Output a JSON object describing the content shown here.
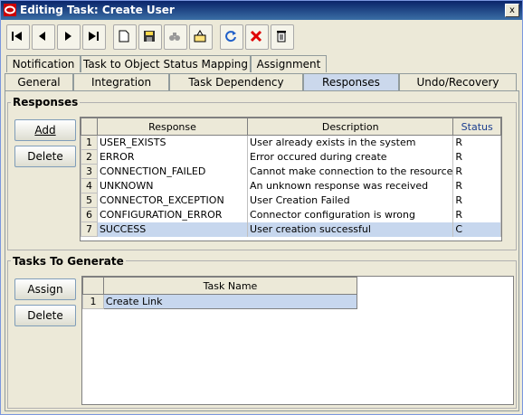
{
  "window": {
    "title": "Editing Task: Create User",
    "close_label": "x"
  },
  "toolbar": {
    "buttons": [
      {
        "icon": "first-record-icon"
      },
      {
        "icon": "previous-record-icon"
      },
      {
        "icon": "next-record-icon"
      },
      {
        "icon": "last-record-icon"
      },
      {
        "icon": "new-document-icon"
      },
      {
        "icon": "save-icon"
      },
      {
        "icon": "find-icon"
      },
      {
        "icon": "assign-icon"
      },
      {
        "icon": "refresh-icon"
      },
      {
        "icon": "delete-x-icon"
      },
      {
        "icon": "trash-icon"
      }
    ]
  },
  "tabs": {
    "row1": [
      "Notification",
      "Task to Object Status Mapping",
      "Assignment"
    ],
    "row2": [
      "General",
      "Integration",
      "Task Dependency",
      "Responses",
      "Undo/Recovery"
    ],
    "active": "Responses"
  },
  "responses": {
    "title": "Responses",
    "add_label": "Add",
    "delete_label": "Delete",
    "columns": [
      "Response",
      "Description",
      "Status"
    ],
    "rows": [
      {
        "n": "1",
        "response": "USER_EXISTS",
        "description": "User already exists in the system",
        "status": "R"
      },
      {
        "n": "2",
        "response": "ERROR",
        "description": "Error occured during create",
        "status": "R"
      },
      {
        "n": "3",
        "response": "CONNECTION_FAILED",
        "description": "Cannot make connection to the resource",
        "status": "R"
      },
      {
        "n": "4",
        "response": "UNKNOWN",
        "description": "An unknown response was received",
        "status": "R"
      },
      {
        "n": "5",
        "response": "CONNECTOR_EXCEPTION",
        "description": "User Creation Failed",
        "status": "R"
      },
      {
        "n": "6",
        "response": "CONFIGURATION_ERROR",
        "description": "Connector configuration is wrong",
        "status": "R"
      },
      {
        "n": "7",
        "response": "SUCCESS",
        "description": "User creation successful",
        "status": "C"
      }
    ],
    "selected_row": "7"
  },
  "tasks": {
    "title": "Tasks To Generate",
    "assign_label": "Assign",
    "delete_label": "Delete",
    "columns": [
      "Task Name"
    ],
    "rows": [
      {
        "n": "1",
        "name": "Create Link"
      }
    ]
  }
}
